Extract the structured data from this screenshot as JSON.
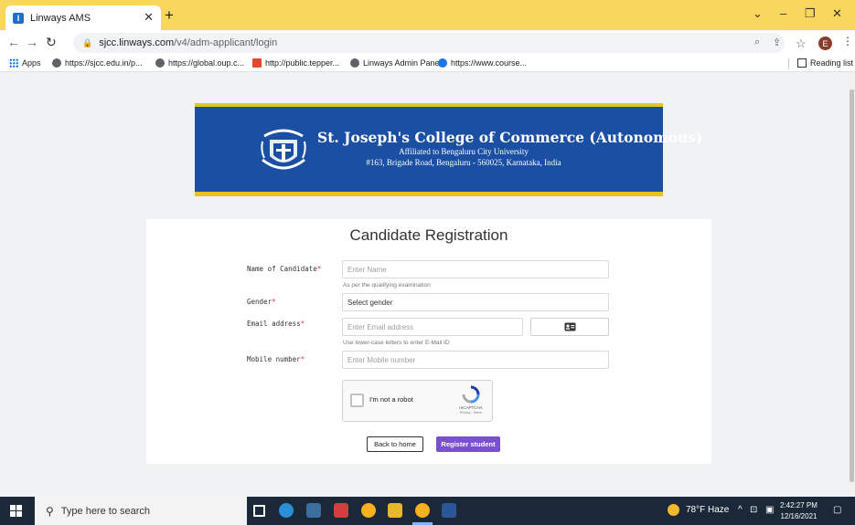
{
  "browser": {
    "tab_title": "Linways AMS",
    "url_host": "sjcc.linways.com",
    "url_path": "/v4/adm-applicant/login",
    "profile_initial": "E",
    "bookmarks": [
      {
        "label": "Apps"
      },
      {
        "label": "https://sjcc.edu.in/p..."
      },
      {
        "label": "https://global.oup.c..."
      },
      {
        "label": "http://public.tepper..."
      },
      {
        "label": "Linways Admin Panel"
      },
      {
        "label": "https://www.course..."
      }
    ],
    "reading_list": "Reading list"
  },
  "banner": {
    "college_name": "St. Joseph's College of Commerce (Autonomous)",
    "affiliation": "Affiliated to Bengaluru City University",
    "address": "#163, Brigade Road, Bengaluru - 560025, Karnataka, India"
  },
  "form": {
    "title": "Candidate Registration",
    "name_label": "Name of Candidate",
    "name_placeholder": "Enter Name",
    "name_hint": "As per the qualifying examination",
    "gender_label": "Gender",
    "gender_value": "Select gender",
    "email_label": "Email address",
    "email_placeholder": "Enter Email address",
    "email_hint": "Use lower-case letters to enter E-Mail ID",
    "mobile_label": "Mobile number",
    "mobile_placeholder": "Enter Mobile number",
    "required_mark": "*",
    "captcha_label": "I'm not a robot",
    "captcha_brand": "reCAPTCHA",
    "captcha_terms": "Privacy - Terms",
    "back_button": "Back to home",
    "register_button": "Register student"
  },
  "taskbar": {
    "search_placeholder": "Type here to search",
    "weather": "78°F  Haze",
    "time": "2:42:27 PM",
    "date": "12/16/2021"
  }
}
